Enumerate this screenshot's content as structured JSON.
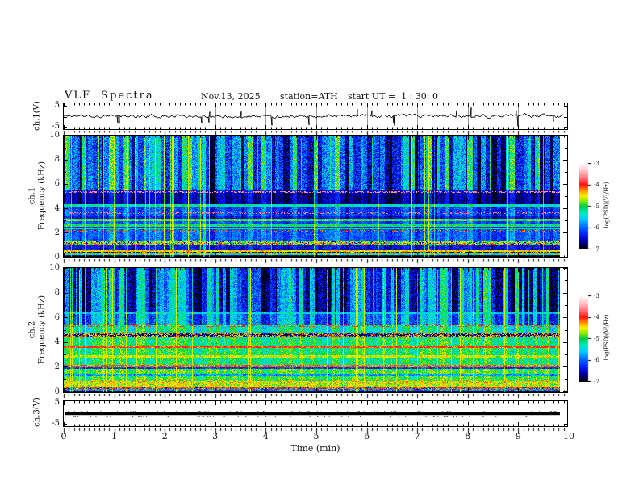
{
  "title_block": {
    "title": "VLF Spectra",
    "date": "Nov.13, 2025",
    "station": "station=ATH",
    "start_ut": "start UT =  1 : 30: 0"
  },
  "axes": {
    "x": {
      "label": "Time (min)",
      "min": 0,
      "max": 10,
      "minor_step": 0.1,
      "tick_labels": [
        "0",
        "1",
        "2",
        "3",
        "4",
        "5",
        "6",
        "7",
        "8",
        "9",
        "10"
      ]
    },
    "spec_y_tick_labels": [
      "10",
      "8",
      "6",
      "4",
      "2",
      "0"
    ],
    "wave_y_tick_labels": [
      "5",
      "-5"
    ]
  },
  "panels": {
    "wave1": {
      "ylabel": "ch.1(V)"
    },
    "spec1": {
      "ylabel_line1": "ch.1",
      "ylabel_line2": "Frequency (kHz)"
    },
    "spec2": {
      "ylabel_line1": "ch.2",
      "ylabel_line2": "Frequency (kHz)"
    },
    "wave3": {
      "ylabel": "ch.3(V)"
    }
  },
  "colorbar": {
    "label": "log(PSD)(V²/Hz)",
    "tick_labels": [
      "-3",
      "-4",
      "-5",
      "-6",
      "-7"
    ],
    "z_range": [
      -7,
      -3
    ],
    "stops": [
      [
        -7.0,
        0,
        0,
        8
      ],
      [
        -6.85,
        0,
        0,
        70
      ],
      [
        -6.6,
        0,
        0,
        180
      ],
      [
        -6.3,
        5,
        35,
        255
      ],
      [
        -5.95,
        0,
        110,
        255
      ],
      [
        -5.6,
        0,
        205,
        255
      ],
      [
        -5.3,
        0,
        235,
        190
      ],
      [
        -5.0,
        0,
        205,
        70
      ],
      [
        -4.75,
        140,
        235,
        0
      ],
      [
        -4.5,
        255,
        240,
        0
      ],
      [
        -4.25,
        255,
        140,
        0
      ],
      [
        -4.0,
        255,
        15,
        15
      ],
      [
        -3.7,
        255,
        110,
        120
      ],
      [
        -3.3,
        255,
        205,
        210
      ],
      [
        -3.0,
        255,
        255,
        255
      ]
    ]
  },
  "chart_data": [
    {
      "type": "line",
      "channel": "ch.1(V)",
      "xlim": [
        0,
        10
      ],
      "ylim": [
        -5,
        5
      ],
      "description": "noisy broadband signal centred near 0 V with impulsive spikes reaching about ±4 V",
      "seed": 11,
      "signal": {
        "baseline": 0.3,
        "noise_amp": 1.1,
        "spike_probability": 0.02,
        "spike_amp": [
          2.2,
          4.6
        ]
      },
      "minute_gridlines": true
    },
    {
      "type": "heatmap",
      "channel": "ch.1",
      "ylabel": "Frequency (kHz)",
      "xlim": [
        0,
        10
      ],
      "ylim": [
        0,
        10
      ],
      "z_label": "log(PSD)(V²/Hz)",
      "z_range": [
        -7,
        -3
      ],
      "seed": 7,
      "data_end_min": 9.82,
      "bands": [
        {
          "f": [
            5.5,
            10
          ],
          "base": -6.35,
          "noise": 0.45,
          "stripe": 1.0
        },
        {
          "f": [
            5.28,
            5.5
          ],
          "base": -6.6,
          "noise": 0.2,
          "stripe": 0.35
        },
        {
          "f": [
            4.35,
            5.28
          ],
          "base": -6.75,
          "noise": 0.2,
          "stripe": 0.3
        },
        {
          "f": [
            4.12,
            4.35
          ],
          "base": -5.35,
          "noise": 0.25,
          "stripe": 0.2
        },
        {
          "f": [
            3.35,
            4.12
          ],
          "base": -6.3,
          "noise": 0.3,
          "stripe": 0.35
        },
        {
          "f": [
            3.18,
            3.35
          ],
          "base": -6.5,
          "noise": 0.2,
          "stripe": 0.3
        },
        {
          "f": [
            2.98,
            3.18
          ],
          "base": -4.95,
          "noise": 0.2,
          "stripe": 0.15
        },
        {
          "f": [
            2.7,
            2.98
          ],
          "base": -6.2,
          "noise": 0.25,
          "stripe": 0.3
        },
        {
          "f": [
            2.52,
            2.7
          ],
          "base": -5.1,
          "noise": 0.2,
          "stripe": 0.15
        },
        {
          "f": [
            2.42,
            2.52
          ],
          "base": -6.3,
          "noise": 0.2,
          "stripe": 0.2
        },
        {
          "f": [
            2.3,
            2.42
          ],
          "base": -5.2,
          "noise": 0.2,
          "stripe": 0.15
        },
        {
          "f": [
            1.28,
            2.3
          ],
          "base": -6.15,
          "noise": 0.3,
          "stripe": 0.3
        },
        {
          "f": [
            0.98,
            1.28
          ],
          "base": -4.8,
          "noise": 0.35,
          "stripe": 0.1,
          "dm": 0.15
        },
        {
          "f": [
            0.55,
            0.98
          ],
          "base": -6.5,
          "noise": 0.3,
          "stripe": 0.2
        },
        {
          "f": [
            0.42,
            0.55
          ],
          "base": -4.45,
          "noise": 0.25,
          "stripe": 0.1
        },
        {
          "f": [
            0.3,
            0.42
          ],
          "base": -4.1,
          "noise": 0.5,
          "stripe": 0.1,
          "dm": 0.4
        },
        {
          "f": [
            0.16,
            0.3
          ],
          "base": -5.0,
          "noise": 0.3,
          "stripe": 0.1
        },
        {
          "f": [
            0.07,
            0.16
          ],
          "base": -6.6,
          "noise": 0.3,
          "stripe": 0.1
        },
        {
          "f": [
            0,
            0.07
          ],
          "base": -6.95,
          "noise": 0.05,
          "stripe": 0
        }
      ],
      "h_lines": [
        {
          "f": 5.35,
          "v": -3.6,
          "p": 0.45
        },
        {
          "f": 3.62,
          "v": -3.65,
          "p": 0.3
        },
        {
          "f": 2.15,
          "v": -4.15,
          "p": 0.25
        },
        {
          "f": 1.08,
          "v": -4.0,
          "p": 0.3
        },
        {
          "f": 0.35,
          "v": -6.9,
          "p": 0.3
        }
      ],
      "stripes": {
        "segMin": 1,
        "segMax": 7,
        "lo": -0.75,
        "hi": 1.5
      },
      "impulses": {
        "p": 0.05,
        "boost": 1.4
      }
    },
    {
      "type": "heatmap",
      "channel": "ch.2",
      "ylabel": "Frequency (kHz)",
      "xlim": [
        0,
        10
      ],
      "ylim": [
        0,
        10
      ],
      "z_label": "log(PSD)(V²/Hz)",
      "z_range": [
        -7,
        -3
      ],
      "seed": 23,
      "data_end_min": 9.82,
      "bands": [
        {
          "f": [
            6.45,
            10
          ],
          "base": -6.35,
          "noise": 0.4,
          "stripe": 1.0
        },
        {
          "f": [
            6.3,
            6.45
          ],
          "base": -5.5,
          "noise": 0.25,
          "stripe": 0.3
        },
        {
          "f": [
            5.42,
            6.3
          ],
          "base": -6.0,
          "noise": 0.35,
          "stripe": 0.7
        },
        {
          "f": [
            5.3,
            5.42
          ],
          "base": -5.0,
          "noise": 0.4,
          "stripe": 0.3
        },
        {
          "f": [
            4.78,
            5.3
          ],
          "base": -5.35,
          "noise": 0.3,
          "stripe": 0.4
        },
        {
          "f": [
            4.5,
            4.78
          ],
          "base": -4.2,
          "noise": 0.5,
          "stripe": 0.1,
          "dm": 0.35
        },
        {
          "f": [
            3.98,
            4.5
          ],
          "base": -5.15,
          "noise": 0.35,
          "stripe": 0.25
        },
        {
          "f": [
            3.72,
            3.98
          ],
          "base": -5.1,
          "noise": 0.3,
          "stripe": 0.2
        },
        {
          "f": [
            3.55,
            3.72
          ],
          "base": -4.2,
          "noise": 0.3,
          "stripe": 0.1
        },
        {
          "f": [
            2.95,
            3.55
          ],
          "base": -5.1,
          "noise": 0.3,
          "stripe": 0.25
        },
        {
          "f": [
            2.72,
            2.95
          ],
          "base": -4.65,
          "noise": 0.25,
          "stripe": 0.15
        },
        {
          "f": [
            2.2,
            2.72
          ],
          "base": -5.15,
          "noise": 0.3,
          "stripe": 0.25
        },
        {
          "f": [
            2.0,
            2.2
          ],
          "base": -4.25,
          "noise": 0.3,
          "stripe": 0.1
        },
        {
          "f": [
            1.88,
            2.0
          ],
          "base": -6.2,
          "noise": 0.35,
          "stripe": 0.1
        },
        {
          "f": [
            1.45,
            1.88
          ],
          "base": -4.95,
          "noise": 0.3,
          "stripe": 0.2
        },
        {
          "f": [
            1.3,
            1.45
          ],
          "base": -5.8,
          "noise": 0.4,
          "stripe": 0.15
        },
        {
          "f": [
            0.88,
            1.3
          ],
          "base": -5.0,
          "noise": 0.35,
          "stripe": 0.2
        },
        {
          "f": [
            0.68,
            0.88
          ],
          "base": -4.45,
          "noise": 0.3,
          "stripe": 0.1
        },
        {
          "f": [
            0.35,
            0.68
          ],
          "base": -4.7,
          "noise": 0.3,
          "stripe": 0.1
        },
        {
          "f": [
            0.22,
            0.35
          ],
          "base": -4.15,
          "noise": 0.4,
          "stripe": 0.1,
          "dm": 0.25
        },
        {
          "f": [
            0.1,
            0.22
          ],
          "base": -5.9,
          "noise": 0.5,
          "stripe": 0.1
        },
        {
          "f": [
            0,
            0.1
          ],
          "base": -6.95,
          "noise": 0.05,
          "stripe": 0
        }
      ],
      "h_lines": [
        {
          "f": 5.35,
          "v": -4.0,
          "p": 0.3
        },
        {
          "f": 4.62,
          "v": -6.9,
          "p": 0.35
        },
        {
          "f": 3.62,
          "v": -4.0,
          "p": 0.5
        },
        {
          "f": 2.08,
          "v": -4.1,
          "p": 0.4
        },
        {
          "f": 0.28,
          "v": -4.05,
          "p": 0.4
        }
      ],
      "stripes": {
        "segMin": 1,
        "segMax": 5,
        "lo": -0.7,
        "hi": 1.3
      },
      "impulses": {
        "p": 0.06,
        "boost": 1.3
      }
    },
    {
      "type": "line",
      "channel": "ch.3(V)",
      "xlim": [
        0,
        10
      ],
      "ylim": [
        -5,
        5
      ],
      "description": "flat saturated trace: thick constant line at 0 V for the whole record",
      "seed": 5,
      "signal": {
        "constant": 0,
        "thickness_v": 1.4
      },
      "data_end_min": 9.82
    }
  ]
}
